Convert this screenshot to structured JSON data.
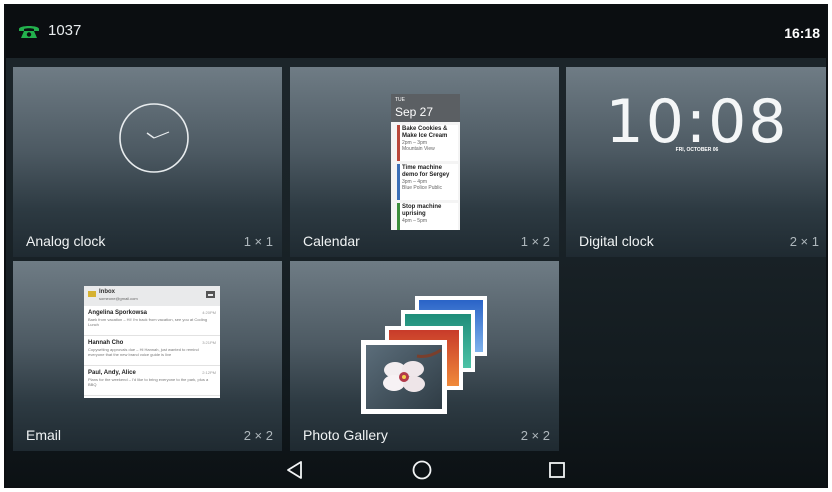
{
  "status_bar": {
    "extension": "1037",
    "time": "16:18",
    "phone_icon": "phone-handset-icon",
    "phone_icon_color": "#23b14d"
  },
  "widgets": [
    {
      "name": "Analog clock",
      "size": "1 × 1"
    },
    {
      "name": "Calendar",
      "size": "1 × 2",
      "preview": {
        "day_of_week": "TUE",
        "date": "Sep 27",
        "events": [
          {
            "title": "Bake Cookies & Make Ice Cream",
            "time": "2pm – 3pm",
            "place": "Mountain View"
          },
          {
            "title": "Time machine demo for Sergey",
            "time": "3pm – 4pm",
            "place": "Blue Police Public"
          },
          {
            "title": "Stop machine uprising",
            "time": "4pm – 5pm",
            "place": ""
          }
        ]
      }
    },
    {
      "name": "Digital clock",
      "size": "2 × 1",
      "preview": {
        "time": "10:08",
        "date": "FRI, OCTOBER 06"
      }
    },
    {
      "name": "Email",
      "size": "2 × 2",
      "preview": {
        "folder": "Inbox",
        "account": "someone@gmail.com",
        "messages": [
          {
            "from": "Angelina Sporkowsa",
            "snippet": "Baek from vacation – Hi! I'm back from vacation, see you at Coding Lunch",
            "time": "4:20PM"
          },
          {
            "from": "Hannah Cho",
            "snippet": "Copywriting approvals due – Hi Hannah, just wanted to remind everyone that the new brand voice guide is live",
            "time": "3:21PM"
          },
          {
            "from": "Paul, Andy, Alice",
            "snippet": "Plans for the weekend – I'd like to bring everyone to the park, plus a BBQ",
            "time": "2:12PM"
          }
        ]
      }
    },
    {
      "name": "Photo Gallery",
      "size": "2 × 2"
    }
  ],
  "navigation": {
    "back_icon": "back-triangle-icon",
    "home_icon": "home-circle-icon",
    "recents_icon": "recents-square-icon"
  },
  "colors": {
    "status_bar_bg": "#0b0e11",
    "tile_top": "#6f7c85",
    "tile_bottom": "#1f2a31"
  }
}
